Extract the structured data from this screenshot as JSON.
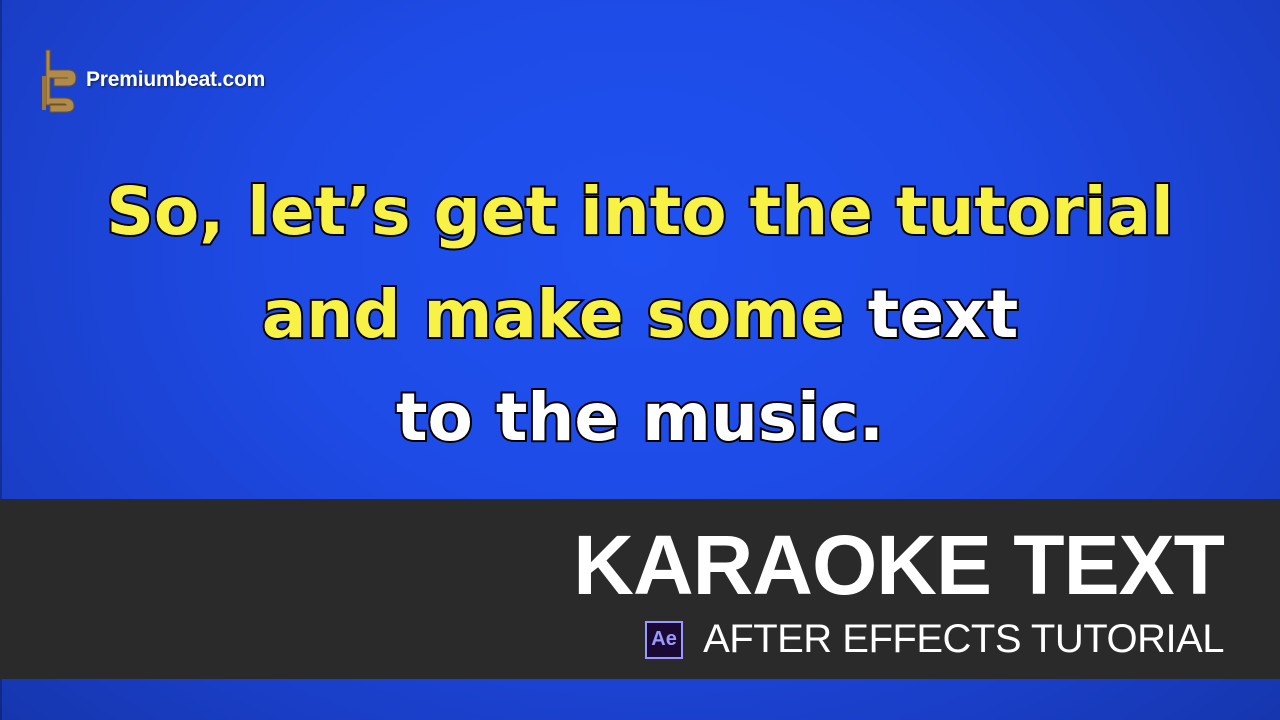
{
  "brand": {
    "name": "Premiumbeat.com",
    "logo_icon": "premiumbeat-logo-icon",
    "logo_color": "#b08a4a"
  },
  "lyrics": {
    "lines": [
      {
        "sung": "So, let’s get into the tutorial",
        "unsung": ""
      },
      {
        "sung": "and make some",
        "unsung": " text"
      },
      {
        "sung": "",
        "unsung": "to the music."
      }
    ],
    "sung_color": "#f8f246",
    "unsung_color": "#ffffff"
  },
  "banner": {
    "title": "KARAOKE TEXT",
    "app_badge": "Ae",
    "app_icon": "after-effects-icon",
    "subtitle": "AFTER EFFECTS TUTORIAL",
    "background": "#2a2a2a"
  },
  "background_color": "#1e4be6"
}
